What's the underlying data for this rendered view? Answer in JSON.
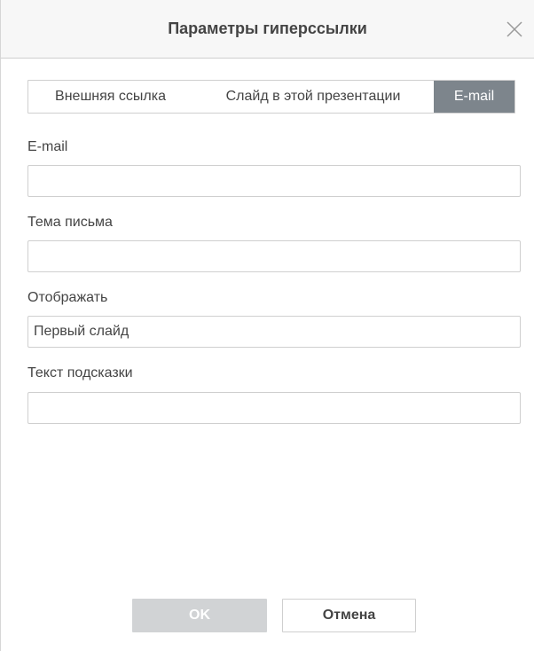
{
  "dialog": {
    "title": "Параметры гиперссылки",
    "close_icon": "close-icon"
  },
  "tabs": [
    {
      "label": "Внешняя ссылка",
      "active": false
    },
    {
      "label": "Слайд в этой презентации",
      "active": false
    },
    {
      "label": "E-mail",
      "active": true
    }
  ],
  "form": {
    "email": {
      "label": "E-mail",
      "value": ""
    },
    "subject": {
      "label": "Тема письма",
      "value": ""
    },
    "display": {
      "label": "Отображать",
      "value": "Первый слайд"
    },
    "tooltip": {
      "label": "Текст подсказки",
      "value": ""
    }
  },
  "buttons": {
    "ok": "OK",
    "cancel": "Отмена"
  },
  "colors": {
    "active_tab": "#7d858c",
    "ok_disabled": "#d1d3d5",
    "border": "#cfcfcf"
  }
}
